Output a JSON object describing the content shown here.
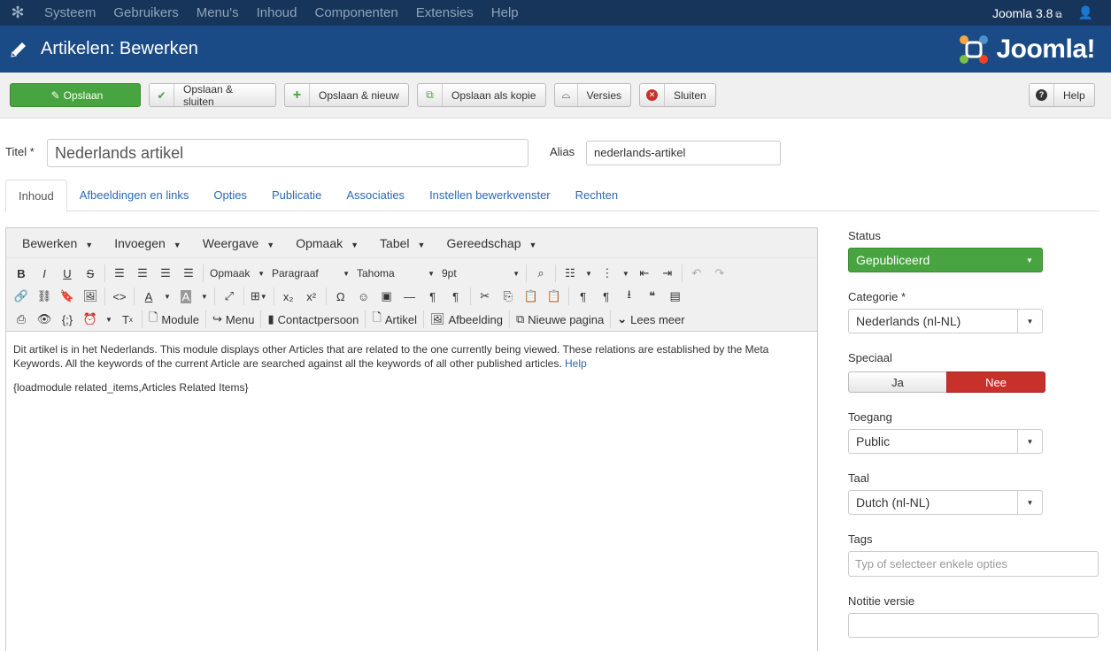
{
  "topnav": {
    "items": [
      "Systeem",
      "Gebruikers",
      "Menu's",
      "Inhoud",
      "Componenten",
      "Extensies",
      "Help"
    ],
    "version": "Joomla 3.8"
  },
  "header": {
    "title": "Artikelen: Bewerken",
    "logo_text": "Joomla!"
  },
  "toolbar": {
    "save": "Opslaan",
    "save_close": "Opslaan & sluiten",
    "save_new": "Opslaan & nieuw",
    "save_copy": "Opslaan als kopie",
    "versions": "Versies",
    "close": "Sluiten",
    "help": "Help"
  },
  "form": {
    "title_label": "Titel *",
    "title_value": "Nederlands artikel",
    "alias_label": "Alias",
    "alias_value": "nederlands-artikel"
  },
  "tabs": [
    "Inhoud",
    "Afbeeldingen en links",
    "Opties",
    "Publicatie",
    "Associaties",
    "Instellen bewerkvenster",
    "Rechten"
  ],
  "editor": {
    "menubar": [
      "Bewerken",
      "Invoegen",
      "Weergave",
      "Opmaak",
      "Tabel",
      "Gereedschap"
    ],
    "format_dd": "Opmaak",
    "block_dd": "Paragraaf",
    "font_dd": "Tahoma",
    "size_dd": "9pt",
    "buttons": {
      "module": "Module",
      "menu": "Menu",
      "contact": "Contactpersoon",
      "article": "Artikel",
      "image": "Afbeelding",
      "pagebreak": "Nieuwe pagina",
      "readmore": "Lees meer"
    },
    "content_p1": "Dit artikel is in het Nederlands. This module displays other Articles that are related to the one currently being viewed. These relations are established by the Meta Keywords. All the keywords of the current Article are searched against all the keywords of all other published articles.",
    "content_link": "Help",
    "content_p2": "{loadmodule related_items,Articles Related Items}"
  },
  "sidebar": {
    "status_label": "Status",
    "status_value": "Gepubliceerd",
    "category_label": "Categorie *",
    "category_value": "Nederlands (nl-NL)",
    "featured_label": "Speciaal",
    "featured_yes": "Ja",
    "featured_no": "Nee",
    "access_label": "Toegang",
    "access_value": "Public",
    "language_label": "Taal",
    "language_value": "Dutch (nl-NL)",
    "tags_label": "Tags",
    "tags_placeholder": "Typ of selecteer enkele opties",
    "version_note_label": "Notitie versie"
  },
  "colors": {
    "topnav": "#17355a",
    "header": "#1b4b86",
    "success": "#48a440",
    "danger": "#c8302c",
    "link": "#2a69b8"
  }
}
